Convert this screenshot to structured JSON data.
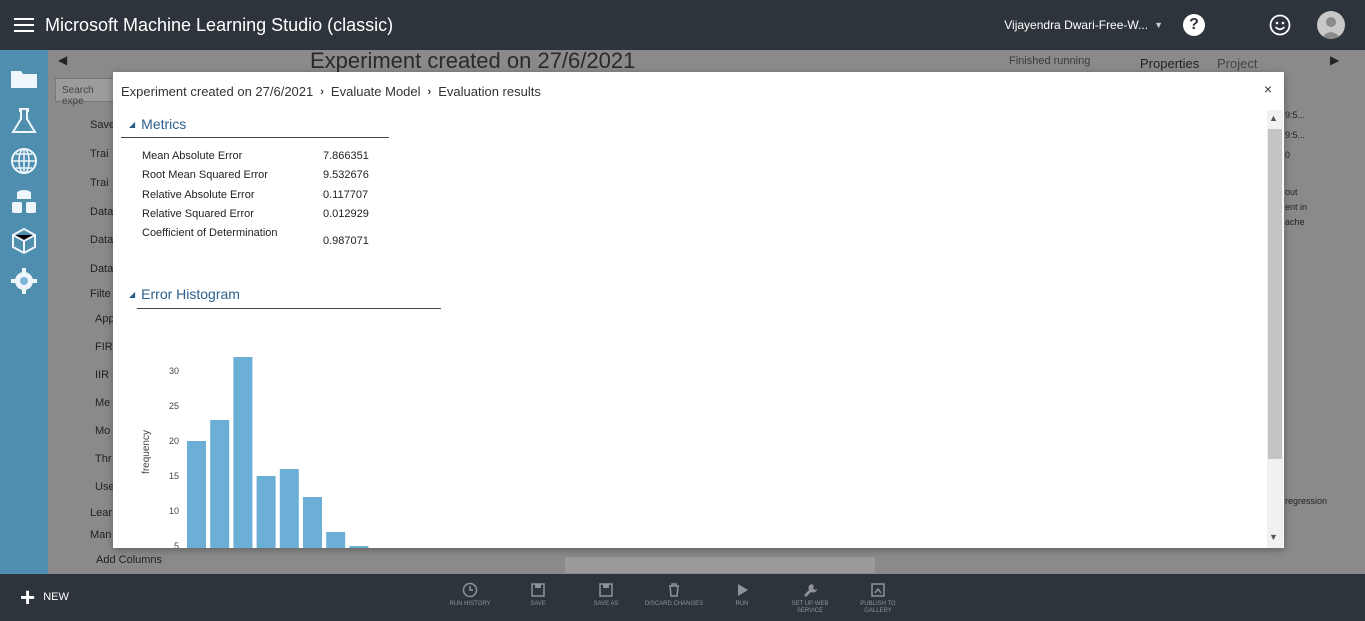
{
  "topbar": {
    "title": "Microsoft Machine Learning Studio (classic)",
    "user_name": "Vijayendra Dwari-Free-W...",
    "help_glyph": "?"
  },
  "background": {
    "experiment_title": "Experiment created on 27/6/2021",
    "status": "Finished running",
    "properties_tab": "Properties",
    "project_tab": "Project",
    "search_placeholder": "Search expe",
    "list_items": [
      "Save",
      "Trai",
      "Trai",
      "Data",
      "Data",
      "Data",
      "Filte",
      "App",
      "FIR",
      "IIR",
      "Me",
      "Mo",
      "Thr",
      "Use",
      "Lear",
      "Man"
    ],
    "add_columns": "Add Columns",
    "right_snippets": [
      "9:5...",
      "9:5...",
      "0",
      "out",
      "ent in",
      "ache",
      "regression"
    ]
  },
  "modal": {
    "breadcrumb": [
      "Experiment created on 27/6/2021",
      "Evaluate Model",
      "Evaluation results"
    ],
    "close_glyph": "×",
    "metrics_title": "Metrics",
    "metrics": [
      {
        "label": "Mean Absolute Error",
        "value": "7.866351"
      },
      {
        "label": "Root Mean Squared Error",
        "value": "9.532676"
      },
      {
        "label": "Relative Absolute Error",
        "value": "0.117707"
      },
      {
        "label": "Relative Squared Error",
        "value": "0.012929"
      },
      {
        "label": "Coefficient of Determination",
        "value": "0.987071"
      }
    ],
    "histogram_title": "Error Histogram"
  },
  "chart_data": {
    "type": "bar",
    "title": "Error Histogram",
    "xlabel": "",
    "ylabel": "frequency",
    "yticks": [
      5,
      10,
      15,
      20,
      25,
      30
    ],
    "values": [
      20,
      23,
      32,
      15,
      16,
      12,
      7,
      5,
      0,
      1
    ],
    "bar_color": "#6baed6"
  },
  "bottombar": {
    "new_label": "NEW",
    "buttons": [
      "RUN HISTORY",
      "SAVE",
      "SAVE AS",
      "DISCARD CHANGES",
      "RUN",
      "SET UP WEB SERVICE",
      "PUBLISH TO GALLERY"
    ]
  },
  "colors": {
    "topbar": "#2e343b",
    "accent_blue": "#2c9fd9",
    "section_title": "#2b5f8c"
  }
}
